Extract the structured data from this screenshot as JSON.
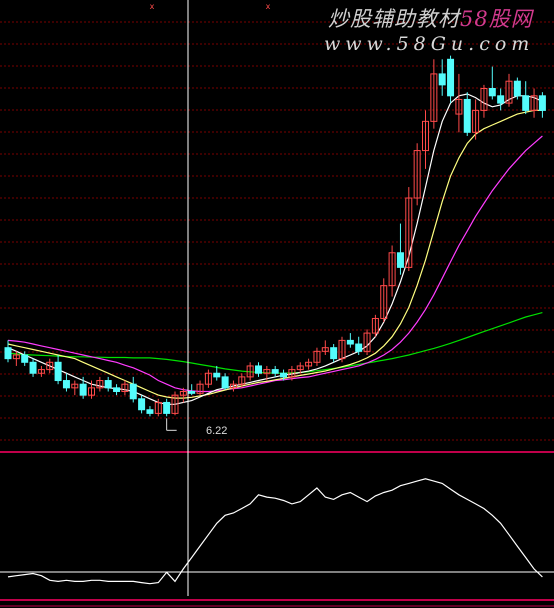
{
  "watermark": {
    "line1_text": "炒股辅助教材",
    "line1_brand": "58股网",
    "line2": "www.58Gu.com"
  },
  "price_panel": {
    "low_marker_label": "6.22",
    "x_markers": [
      "x",
      "x"
    ]
  },
  "colors": {
    "background": "#000000",
    "up_candle": "#ff4a4a",
    "down_candle": "#54fcfc",
    "ma_short": "#ffffff",
    "ma_mid": "#ffff80",
    "ma_long": "#ff3cff",
    "ma_longest": "#00e000",
    "grid": "#7a0000",
    "panel_border": "#c0004a",
    "crosshair": "#ffffff"
  },
  "chart_data": [
    {
      "type": "candlestick",
      "title": "",
      "ylim": [
        5.9,
        16.2
      ],
      "candles": [
        {
          "o": 8.1,
          "h": 8.3,
          "l": 7.7,
          "c": 7.8
        },
        {
          "o": 7.8,
          "h": 8.0,
          "l": 7.6,
          "c": 7.9
        },
        {
          "o": 7.9,
          "h": 8.0,
          "l": 7.6,
          "c": 7.7
        },
        {
          "o": 7.7,
          "h": 7.8,
          "l": 7.3,
          "c": 7.4
        },
        {
          "o": 7.4,
          "h": 7.6,
          "l": 7.3,
          "c": 7.5
        },
        {
          "o": 7.5,
          "h": 7.8,
          "l": 7.4,
          "c": 7.7
        },
        {
          "o": 7.7,
          "h": 7.9,
          "l": 7.1,
          "c": 7.2
        },
        {
          "o": 7.2,
          "h": 7.4,
          "l": 6.9,
          "c": 7.0
        },
        {
          "o": 7.0,
          "h": 7.2,
          "l": 6.8,
          "c": 7.1
        },
        {
          "o": 7.1,
          "h": 7.3,
          "l": 6.7,
          "c": 6.8
        },
        {
          "o": 6.8,
          "h": 7.2,
          "l": 6.7,
          "c": 7.0
        },
        {
          "o": 7.0,
          "h": 7.3,
          "l": 6.9,
          "c": 7.2
        },
        {
          "o": 7.2,
          "h": 7.3,
          "l": 6.9,
          "c": 7.0
        },
        {
          "o": 7.0,
          "h": 7.1,
          "l": 6.8,
          "c": 6.9
        },
        {
          "o": 6.9,
          "h": 7.2,
          "l": 6.8,
          "c": 7.1
        },
        {
          "o": 7.1,
          "h": 7.3,
          "l": 6.6,
          "c": 6.7
        },
        {
          "o": 6.7,
          "h": 6.8,
          "l": 6.3,
          "c": 6.4
        },
        {
          "o": 6.4,
          "h": 6.5,
          "l": 6.22,
          "c": 6.3
        },
        {
          "o": 6.3,
          "h": 6.7,
          "l": 6.22,
          "c": 6.6
        },
        {
          "o": 6.6,
          "h": 6.7,
          "l": 6.22,
          "c": 6.3
        },
        {
          "o": 6.3,
          "h": 6.9,
          "l": 6.25,
          "c": 6.8
        },
        {
          "o": 6.8,
          "h": 7.0,
          "l": 6.6,
          "c": 6.9
        },
        {
          "o": 6.9,
          "h": 7.1,
          "l": 6.8,
          "c": 6.85
        },
        {
          "o": 6.85,
          "h": 7.2,
          "l": 6.8,
          "c": 7.1
        },
        {
          "o": 7.1,
          "h": 7.5,
          "l": 7.0,
          "c": 7.4
        },
        {
          "o": 7.4,
          "h": 7.6,
          "l": 7.2,
          "c": 7.3
        },
        {
          "o": 7.3,
          "h": 7.4,
          "l": 6.95,
          "c": 7.0
        },
        {
          "o": 7.0,
          "h": 7.2,
          "l": 6.9,
          "c": 7.1
        },
        {
          "o": 7.1,
          "h": 7.4,
          "l": 7.0,
          "c": 7.3
        },
        {
          "o": 7.3,
          "h": 7.7,
          "l": 7.2,
          "c": 7.6
        },
        {
          "o": 7.6,
          "h": 7.7,
          "l": 7.3,
          "c": 7.4
        },
        {
          "o": 7.4,
          "h": 7.6,
          "l": 7.2,
          "c": 7.5
        },
        {
          "o": 7.5,
          "h": 7.6,
          "l": 7.3,
          "c": 7.4
        },
        {
          "o": 7.4,
          "h": 7.5,
          "l": 7.2,
          "c": 7.3
        },
        {
          "o": 7.3,
          "h": 7.6,
          "l": 7.2,
          "c": 7.5
        },
        {
          "o": 7.5,
          "h": 7.7,
          "l": 7.4,
          "c": 7.6
        },
        {
          "o": 7.6,
          "h": 7.8,
          "l": 7.5,
          "c": 7.7
        },
        {
          "o": 7.7,
          "h": 8.1,
          "l": 7.6,
          "c": 8.0
        },
        {
          "o": 8.0,
          "h": 8.3,
          "l": 7.9,
          "c": 8.1
        },
        {
          "o": 8.1,
          "h": 8.2,
          "l": 7.7,
          "c": 7.8
        },
        {
          "o": 7.8,
          "h": 8.4,
          "l": 7.7,
          "c": 8.3
        },
        {
          "o": 8.3,
          "h": 8.5,
          "l": 8.1,
          "c": 8.2
        },
        {
          "o": 8.2,
          "h": 8.4,
          "l": 7.9,
          "c": 8.0
        },
        {
          "o": 8.0,
          "h": 8.6,
          "l": 7.9,
          "c": 8.5
        },
        {
          "o": 8.5,
          "h": 9.0,
          "l": 8.4,
          "c": 8.9
        },
        {
          "o": 8.9,
          "h": 10.0,
          "l": 8.8,
          "c": 9.8
        },
        {
          "o": 9.8,
          "h": 10.9,
          "l": 9.5,
          "c": 10.7
        },
        {
          "o": 10.7,
          "h": 11.5,
          "l": 10.1,
          "c": 10.3
        },
        {
          "o": 10.3,
          "h": 12.5,
          "l": 10.2,
          "c": 12.2
        },
        {
          "o": 12.2,
          "h": 13.7,
          "l": 12.0,
          "c": 13.5
        },
        {
          "o": 13.5,
          "h": 14.6,
          "l": 13.0,
          "c": 14.3
        },
        {
          "o": 14.3,
          "h": 16.0,
          "l": 14.1,
          "c": 15.6
        },
        {
          "o": 15.6,
          "h": 16.0,
          "l": 15.0,
          "c": 15.3
        },
        {
          "o": 16.0,
          "h": 16.1,
          "l": 14.8,
          "c": 15.0
        },
        {
          "o": 14.5,
          "h": 15.6,
          "l": 14.0,
          "c": 14.9
        },
        {
          "o": 14.9,
          "h": 15.1,
          "l": 13.9,
          "c": 14.0
        },
        {
          "o": 14.0,
          "h": 14.9,
          "l": 13.8,
          "c": 14.6
        },
        {
          "o": 14.6,
          "h": 15.3,
          "l": 14.4,
          "c": 15.2
        },
        {
          "o": 15.2,
          "h": 15.8,
          "l": 14.9,
          "c": 15.0
        },
        {
          "o": 15.0,
          "h": 15.2,
          "l": 14.6,
          "c": 14.8
        },
        {
          "o": 14.8,
          "h": 15.6,
          "l": 14.7,
          "c": 15.4
        },
        {
          "o": 15.4,
          "h": 15.5,
          "l": 14.9,
          "c": 15.0
        },
        {
          "o": 15.0,
          "h": 15.4,
          "l": 14.5,
          "c": 14.6
        },
        {
          "o": 14.6,
          "h": 15.2,
          "l": 14.4,
          "c": 15.0
        },
        {
          "o": 15.0,
          "h": 15.1,
          "l": 14.4,
          "c": 14.6
        }
      ],
      "ma_short": [
        8.1,
        8.0,
        7.9,
        7.8,
        7.7,
        7.6,
        7.5,
        7.4,
        7.3,
        7.2,
        7.1,
        7.05,
        7.0,
        6.98,
        6.95,
        6.9,
        6.8,
        6.7,
        6.6,
        6.55,
        6.55,
        6.6,
        6.65,
        6.75,
        6.85,
        6.95,
        7.0,
        7.05,
        7.1,
        7.15,
        7.2,
        7.25,
        7.3,
        7.35,
        7.38,
        7.42,
        7.46,
        7.52,
        7.6,
        7.7,
        7.8,
        7.9,
        8.0,
        8.15,
        8.4,
        8.8,
        9.3,
        9.9,
        10.6,
        11.5,
        12.5,
        13.5,
        14.3,
        14.8,
        15.0,
        15.05,
        14.95,
        14.8,
        14.7,
        14.75,
        14.9,
        15.0,
        15.0,
        14.95,
        14.85
      ],
      "ma_mid": [
        8.2,
        8.15,
        8.1,
        8.05,
        8.0,
        7.95,
        7.9,
        7.85,
        7.8,
        7.7,
        7.6,
        7.5,
        7.4,
        7.3,
        7.2,
        7.1,
        7.0,
        6.9,
        6.8,
        6.75,
        6.72,
        6.72,
        6.74,
        6.78,
        6.82,
        6.88,
        6.94,
        7.0,
        7.05,
        7.1,
        7.15,
        7.18,
        7.22,
        7.26,
        7.3,
        7.34,
        7.38,
        7.42,
        7.46,
        7.52,
        7.58,
        7.64,
        7.72,
        7.82,
        7.95,
        8.15,
        8.4,
        8.75,
        9.2,
        9.8,
        10.5,
        11.3,
        12.1,
        12.8,
        13.3,
        13.7,
        13.95,
        14.1,
        14.2,
        14.3,
        14.4,
        14.5,
        14.55,
        14.6,
        14.6
      ],
      "ma_long": [
        8.3,
        8.28,
        8.25,
        8.2,
        8.15,
        8.1,
        8.05,
        8.0,
        7.95,
        7.9,
        7.85,
        7.8,
        7.75,
        7.7,
        7.62,
        7.55,
        7.45,
        7.35,
        7.2,
        7.1,
        7.0,
        6.95,
        6.92,
        6.9,
        6.9,
        6.92,
        6.95,
        6.98,
        7.0,
        7.05,
        7.1,
        7.15,
        7.2,
        7.22,
        7.25,
        7.28,
        7.3,
        7.35,
        7.4,
        7.45,
        7.5,
        7.55,
        7.6,
        7.68,
        7.78,
        7.9,
        8.05,
        8.25,
        8.5,
        8.8,
        9.15,
        9.55,
        10.0,
        10.45,
        10.9,
        11.3,
        11.7,
        12.05,
        12.4,
        12.7,
        13.0,
        13.25,
        13.5,
        13.7,
        13.9
      ],
      "ma_longest": [
        7.95,
        7.93,
        7.91,
        7.9,
        7.89,
        7.88,
        7.87,
        7.86,
        7.85,
        7.85,
        7.84,
        7.84,
        7.83,
        7.83,
        7.83,
        7.82,
        7.82,
        7.82,
        7.8,
        7.78,
        7.75,
        7.72,
        7.68,
        7.64,
        7.6,
        7.56,
        7.52,
        7.49,
        7.46,
        7.44,
        7.42,
        7.41,
        7.4,
        7.4,
        7.41,
        7.42,
        7.44,
        7.47,
        7.5,
        7.53,
        7.56,
        7.6,
        7.64,
        7.68,
        7.72,
        7.76,
        7.8,
        7.85,
        7.9,
        7.96,
        8.02,
        8.08,
        8.15,
        8.22,
        8.3,
        8.38,
        8.46,
        8.54,
        8.62,
        8.7,
        8.78,
        8.86,
        8.94,
        9.0,
        9.06
      ]
    },
    {
      "type": "line",
      "title": "",
      "ylim": [
        0,
        100
      ],
      "values": [
        8,
        9,
        10,
        11,
        9,
        5,
        4,
        5,
        4,
        4,
        5,
        5,
        4,
        4,
        4,
        4,
        3,
        2,
        3,
        12,
        4,
        15,
        25,
        35,
        45,
        55,
        62,
        64,
        68,
        72,
        80,
        78,
        77,
        75,
        72,
        74,
        80,
        86,
        78,
        76,
        80,
        82,
        78,
        74,
        79,
        82,
        84,
        88,
        90,
        92,
        94,
        92,
        90,
        85,
        80,
        76,
        72,
        68,
        62,
        55,
        45,
        35,
        25,
        15,
        8
      ],
      "xlim": [
        0,
        64
      ]
    }
  ]
}
